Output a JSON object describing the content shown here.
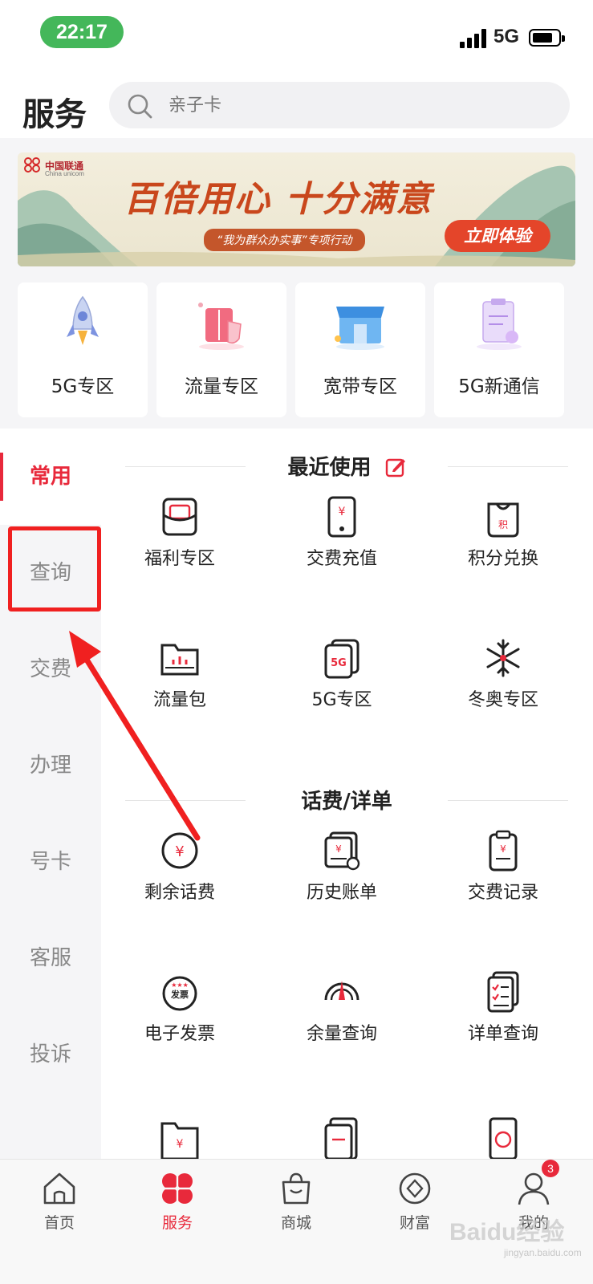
{
  "status_bar": {
    "time": "22:17",
    "network": "5G",
    "battery_level": 0.7
  },
  "header": {
    "title": "服务",
    "search_placeholder": "亲子卡"
  },
  "banner": {
    "brand": "中国联通",
    "brand_en": "China unicom",
    "title": "百倍用心 十分满意",
    "subtitle": "“我为群众办实事”专项行动",
    "cta": "立即体验"
  },
  "zones": [
    {
      "label": "5G专区",
      "icon": "rocket-icon"
    },
    {
      "label": "流量专区",
      "icon": "traffic-icon"
    },
    {
      "label": "宽带专区",
      "icon": "broadband-store-icon"
    },
    {
      "label": "5G新通信",
      "icon": "new-communication-icon"
    }
  ],
  "sidebar": {
    "items": [
      {
        "label": "常用",
        "active": true
      },
      {
        "label": "查询",
        "active": false
      },
      {
        "label": "交费",
        "active": false
      },
      {
        "label": "办理",
        "active": false
      },
      {
        "label": "号卡",
        "active": false
      },
      {
        "label": "客服",
        "active": false
      },
      {
        "label": "投诉",
        "active": false
      }
    ]
  },
  "sections": [
    {
      "title": "最近使用",
      "items": [
        {
          "label": "福利专区",
          "icon": "welfare-icon"
        },
        {
          "label": "交费充值",
          "icon": "phone-recharge-icon"
        },
        {
          "label": "积分兑换",
          "icon": "points-bag-icon"
        },
        {
          "label": "流量包",
          "icon": "data-folder-icon"
        },
        {
          "label": "5G专区",
          "icon": "5g-cards-icon"
        },
        {
          "label": "冬奥专区",
          "icon": "snowflake-icon"
        }
      ]
    },
    {
      "title": "话费/详单",
      "items": [
        {
          "label": "剩余话费",
          "icon": "yuan-circle-icon"
        },
        {
          "label": "历史账单",
          "icon": "history-bill-icon"
        },
        {
          "label": "交费记录",
          "icon": "payment-record-icon"
        },
        {
          "label": "电子发票",
          "icon": "invoice-icon"
        },
        {
          "label": "余量查询",
          "icon": "gauge-icon"
        },
        {
          "label": "详单查询",
          "icon": "checklist-icon"
        }
      ]
    }
  ],
  "tabbar": {
    "items": [
      {
        "label": "首页",
        "icon": "home-icon",
        "active": false
      },
      {
        "label": "服务",
        "icon": "service-clover-icon",
        "active": true
      },
      {
        "label": "商城",
        "icon": "shopping-bag-icon",
        "active": false
      },
      {
        "label": "财富",
        "icon": "wealth-icon",
        "active": false
      },
      {
        "label": "我的",
        "icon": "profile-icon",
        "active": false,
        "badge": "3"
      }
    ]
  },
  "watermark": {
    "text": "Baidu经验",
    "sub": "jingyan.baidu.com"
  },
  "colors": {
    "accent": "#e8293b",
    "time_pill": "#44b75a",
    "annotation": "#f02020"
  }
}
